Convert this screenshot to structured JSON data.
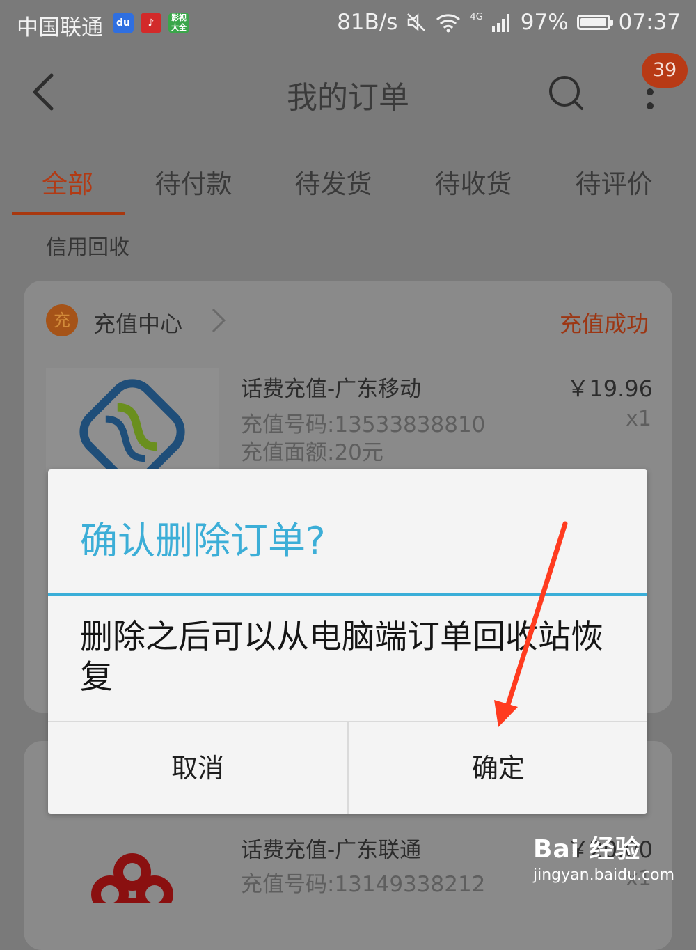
{
  "status_bar": {
    "carrier": "中国联通",
    "net_speed": "81B/s",
    "network_type": "4G",
    "battery": "97%",
    "time": "07:37",
    "app_icons": [
      "baidu-icon",
      "music-app-icon",
      "video-app-icon"
    ],
    "video_app_label": "影视大全"
  },
  "header": {
    "title": "我的订单",
    "badge_count": "39"
  },
  "tabs": [
    {
      "label": "全部",
      "active": true
    },
    {
      "label": "待付款",
      "active": false
    },
    {
      "label": "待发货",
      "active": false
    },
    {
      "label": "待收货",
      "active": false
    },
    {
      "label": "待评价",
      "active": false
    }
  ],
  "recycle_link": "信用回收",
  "orders": [
    {
      "shop_icon_text": "充",
      "shop_name": "充值中心",
      "status": "充值成功",
      "title": "话费充值-广东移动",
      "number_line": "充值号码:13533838810",
      "amount_line": "充值面额:20元",
      "price": "￥19.96",
      "qty": "x1"
    },
    {
      "title": "话费充值-广东联通",
      "number_line": "充值号码:13149338212",
      "price": "￥20.00",
      "qty": "x1"
    }
  ],
  "dialog": {
    "title": "确认删除订单?",
    "message": "删除之后可以从电脑端订单回收站恢复",
    "cancel_label": "取消",
    "confirm_label": "确定"
  },
  "watermark": {
    "logo": "Bai 经验",
    "url": "jingyan.baidu.com"
  },
  "colors": {
    "accent": "#3aaed8",
    "tab_active": "#b23a14",
    "annotation_arrow": "#ff3b1f"
  }
}
